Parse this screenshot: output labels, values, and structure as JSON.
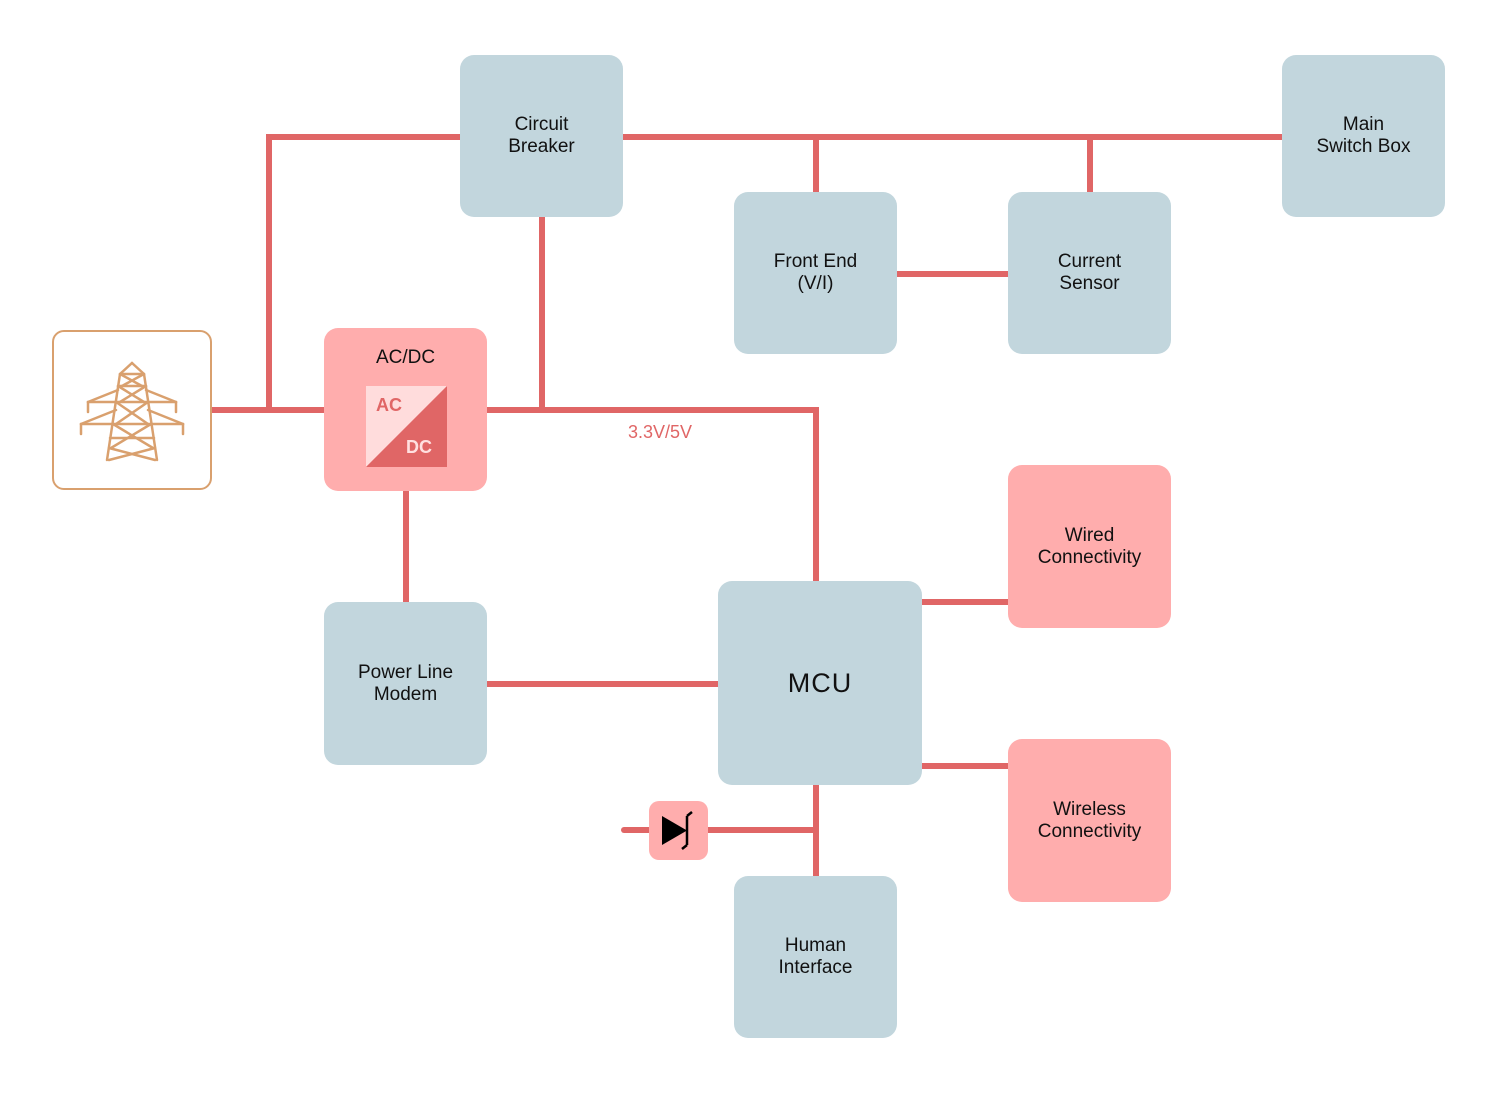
{
  "colors": {
    "wire": "#e06666",
    "block_blue": "#c2d6dd",
    "block_pink": "#ffadad",
    "tower": "#d9a06e",
    "label_red": "#e06666"
  },
  "blocks": {
    "circuit_breaker": "Circuit\nBreaker",
    "main_switch_box": "Main\nSwitch Box",
    "front_end": "Front End\n(V/I)",
    "current_sensor": "Current\nSensor",
    "acdc_title": "AC/DC",
    "acdc_ac": "AC",
    "acdc_dc": "DC",
    "power_line_modem": "Power Line\nModem",
    "mcu": "MCU",
    "wired_connectivity": "Wired\nConnectivity",
    "wireless_connectivity": "Wireless\nConnectivity",
    "human_interface": "Human\nInterface"
  },
  "labels": {
    "voltage": "3.3V/5V"
  },
  "icons": {
    "power_source": "transmission-tower-icon",
    "protection": "tvs-diode-icon"
  }
}
